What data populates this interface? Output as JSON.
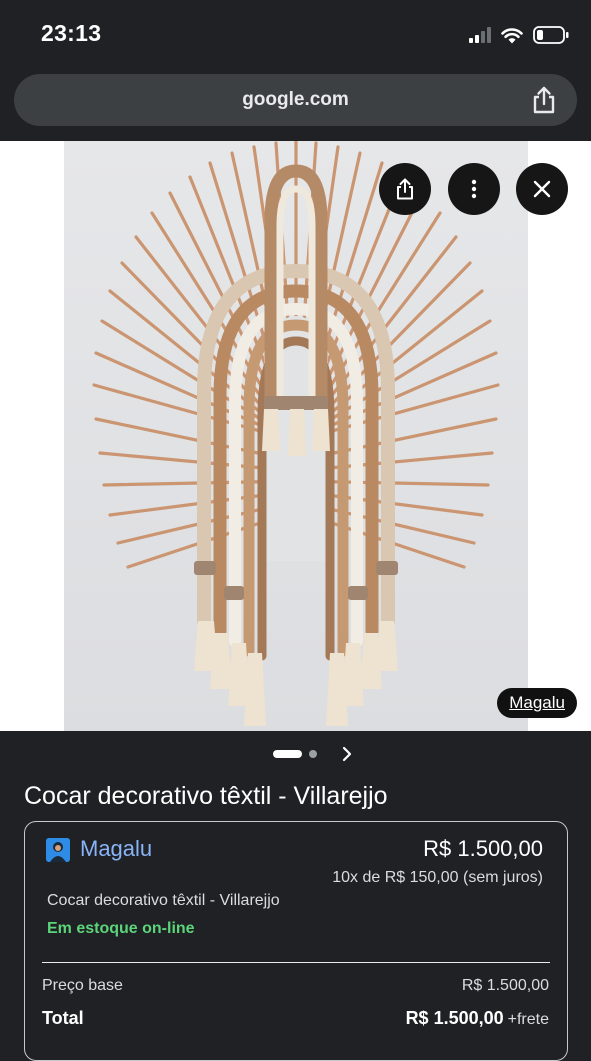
{
  "status": {
    "time": "23:13"
  },
  "browser": {
    "url": "google.com"
  },
  "image": {
    "source_label": "Magalu"
  },
  "carousel": {
    "active_index": 0,
    "total": 2
  },
  "product": {
    "title": "Cocar decorativo têxtil - Villarejjo"
  },
  "offer": {
    "store": "Magalu",
    "price": "R$ 1.500,00",
    "installments": "10x de R$ 150,00 (sem juros)",
    "description": "Cocar decorativo têxtil - Villarejjo",
    "stock": "Em estoque on-line",
    "base_label": "Preço base",
    "base_value": "R$ 1.500,00",
    "total_label": "Total",
    "total_value": "R$ 1.500,00",
    "shipping": "+frete"
  },
  "icons": {
    "share": "share-icon",
    "more": "more-vert-icon",
    "close": "close-icon",
    "next": "chevron-right-icon",
    "signal": "cellular-signal-icon",
    "wifi": "wifi-icon",
    "battery": "battery-icon"
  },
  "colors": {
    "background": "#1f2124",
    "link": "#8ab4f8",
    "in_stock": "#5bd47a"
  }
}
